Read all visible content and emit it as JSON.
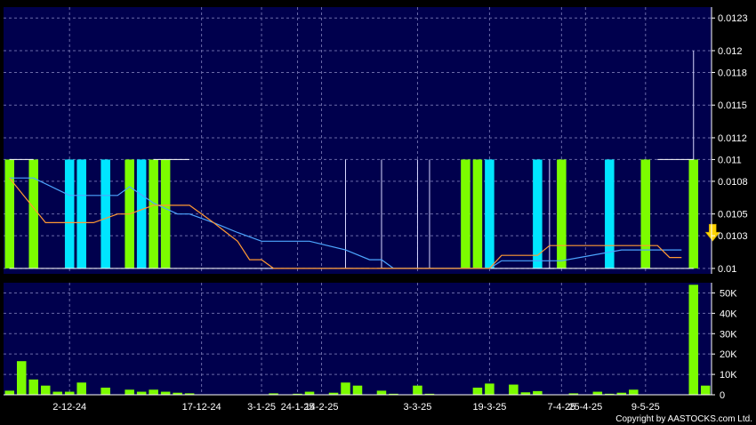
{
  "chart_data": [
    {
      "type": "candlestick",
      "y_ticks": [
        0.01,
        0.0103,
        0.0105,
        0.0108,
        0.011,
        0.0112,
        0.0115,
        0.0118,
        0.012,
        0.0123
      ],
      "ylim": [
        0.00995,
        0.0124
      ],
      "grid": true,
      "bars": [
        {
          "i": 0,
          "o": 0.01,
          "c": 0.011,
          "h": 0.011,
          "l": 0.01
        },
        {
          "i": 2,
          "o": 0.01,
          "c": 0.011,
          "h": 0.011,
          "l": 0.01
        },
        {
          "i": 5,
          "o": 0.011,
          "c": 0.01,
          "h": 0.011,
          "l": 0.01
        },
        {
          "i": 6,
          "o": 0.011,
          "c": 0.01,
          "h": 0.011,
          "l": 0.01
        },
        {
          "i": 8,
          "o": 0.011,
          "c": 0.01,
          "h": 0.011,
          "l": 0.01
        },
        {
          "i": 10,
          "o": 0.01,
          "c": 0.011,
          "h": 0.011,
          "l": 0.01
        },
        {
          "i": 11,
          "o": 0.011,
          "c": 0.01,
          "h": 0.011,
          "l": 0.01
        },
        {
          "i": 12,
          "o": 0.01,
          "c": 0.011,
          "h": 0.011,
          "l": 0.01
        },
        {
          "i": 13,
          "o": 0.01,
          "c": 0.011,
          "h": 0.011,
          "l": 0.01
        },
        {
          "i": 28,
          "o": 0.01,
          "c": 0.01,
          "h": 0.011,
          "l": 0.01
        },
        {
          "i": 31,
          "o": 0.01,
          "c": 0.01,
          "h": 0.011,
          "l": 0.01
        },
        {
          "i": 34,
          "o": 0.01,
          "c": 0.01,
          "h": 0.011,
          "l": 0.01
        },
        {
          "i": 35,
          "o": 0.01,
          "c": 0.01,
          "h": 0.011,
          "l": 0.01
        },
        {
          "i": 38,
          "o": 0.01,
          "c": 0.011,
          "h": 0.011,
          "l": 0.01
        },
        {
          "i": 39,
          "o": 0.01,
          "c": 0.011,
          "h": 0.011,
          "l": 0.01
        },
        {
          "i": 40,
          "o": 0.011,
          "c": 0.01,
          "h": 0.011,
          "l": 0.01
        },
        {
          "i": 44,
          "o": 0.011,
          "c": 0.01,
          "h": 0.011,
          "l": 0.01
        },
        {
          "i": 45,
          "o": 0.01,
          "c": 0.01,
          "h": 0.011,
          "l": 0.01
        },
        {
          "i": 46,
          "o": 0.01,
          "c": 0.011,
          "h": 0.011,
          "l": 0.01
        },
        {
          "i": 50,
          "o": 0.011,
          "c": 0.01,
          "h": 0.011,
          "l": 0.01
        },
        {
          "i": 53,
          "o": 0.01,
          "c": 0.011,
          "h": 0.011,
          "l": 0.01
        },
        {
          "i": 57,
          "o": 0.01,
          "c": 0.011,
          "h": 0.012,
          "l": 0.01
        }
      ],
      "ma_blue": [
        [
          0,
          0.01083
        ],
        [
          2,
          0.01083
        ],
        [
          5,
          0.01067
        ],
        [
          7,
          0.01067
        ],
        [
          9,
          0.01067
        ],
        [
          10,
          0.01075
        ],
        [
          12,
          0.0106
        ],
        [
          14,
          0.0105
        ],
        [
          15,
          0.0105
        ],
        [
          17,
          0.01042
        ],
        [
          19,
          0.01033
        ],
        [
          21,
          0.01025
        ],
        [
          25,
          0.01025
        ],
        [
          28,
          0.01017
        ],
        [
          30,
          0.01008
        ],
        [
          31,
          0.01008
        ],
        [
          32,
          0.01
        ],
        [
          40,
          0.01
        ],
        [
          41,
          0.01007
        ],
        [
          46,
          0.01007
        ],
        [
          51,
          0.01017
        ],
        [
          56,
          0.01017
        ]
      ],
      "ma_orange": [
        [
          0,
          0.01083
        ],
        [
          3,
          0.01042
        ],
        [
          7,
          0.01042
        ],
        [
          9,
          0.0105
        ],
        [
          10,
          0.0105
        ],
        [
          12,
          0.01058
        ],
        [
          15,
          0.01058
        ],
        [
          17,
          0.01042
        ],
        [
          19,
          0.01025
        ],
        [
          20,
          0.01008
        ],
        [
          21,
          0.01008
        ],
        [
          22,
          0.01
        ],
        [
          40,
          0.01
        ],
        [
          41,
          0.01012
        ],
        [
          44,
          0.01012
        ],
        [
          45,
          0.01021
        ],
        [
          54,
          0.01021
        ],
        [
          55,
          0.0101
        ],
        [
          56,
          0.0101
        ]
      ],
      "colors": {
        "up": "#7cfc00",
        "down": "#00e5ff",
        "ma_blue": "#4da6ff",
        "ma_orange": "#ff9933",
        "arrow": "#ffd400"
      }
    },
    {
      "type": "bar",
      "y_ticks": [
        "0",
        "10K",
        "20K",
        "30K",
        "40K",
        "50K"
      ],
      "ylim": [
        0,
        55000
      ],
      "grid": true,
      "values": [
        2000,
        16500,
        7500,
        4500,
        1500,
        1500,
        6000,
        0,
        3500,
        0,
        2500,
        1500,
        2500,
        1500,
        1000,
        700,
        0,
        0,
        0,
        0,
        0,
        0,
        700,
        0,
        500,
        1500,
        0,
        1000,
        6000,
        4500,
        0,
        2000,
        500,
        0,
        4500,
        500,
        0,
        0,
        0,
        3500,
        5500,
        0,
        5000,
        1200,
        1800,
        0,
        0,
        700,
        0,
        1500,
        500,
        1000,
        2500,
        0,
        0,
        0,
        0,
        54000,
        4500
      ],
      "color": "#7cfc00"
    }
  ],
  "x_ticks": [
    {
      "i": 5,
      "label": "2-12-24"
    },
    {
      "i": 16,
      "label": "17-12-24"
    },
    {
      "i": 21,
      "label": "3-1-25"
    },
    {
      "i": 24,
      "label": "24-1-25"
    },
    {
      "i": 26,
      "label": "14-2-25"
    },
    {
      "i": 34,
      "label": "3-3-25"
    },
    {
      "i": 40,
      "label": "19-3-25"
    },
    {
      "i": 46,
      "label": "7-4-25"
    },
    {
      "i": 48,
      "label": "25-4-25"
    },
    {
      "i": 53,
      "label": "9-5-25"
    }
  ],
  "copyright": "Copyright by AASTOCKS.com Ltd."
}
